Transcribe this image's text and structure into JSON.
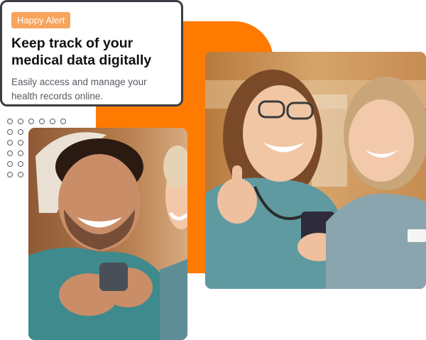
{
  "alert": {
    "badge": "Happy Alert",
    "title": "Keep track of your medical data digitally",
    "subtitle": "Easily access and manage your health records online."
  },
  "colors": {
    "accent_orange": "#ff7a00",
    "badge_orange": "#f7a45c",
    "card_border": "#3a3d43",
    "title_text": "#111111",
    "subtitle_text": "#555a61"
  },
  "icons": {
    "dot_pattern": "dot-grid-decoration"
  }
}
